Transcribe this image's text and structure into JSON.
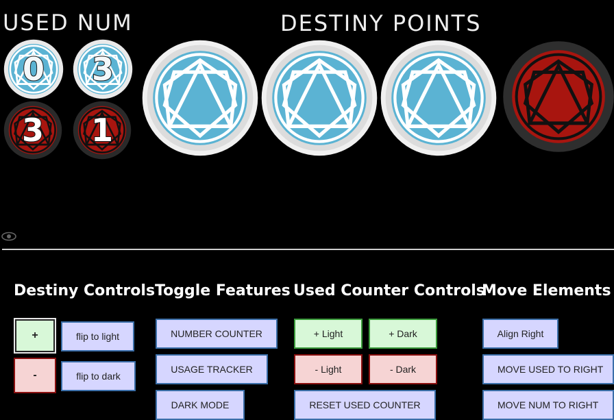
{
  "headers": {
    "used_num": "USED NUM",
    "destiny_points": "DESTINY POINTS"
  },
  "counters": {
    "light_used": "0",
    "light_num": "3",
    "dark_used": "3",
    "dark_num": "1"
  },
  "destiny_tokens": [
    "light",
    "light",
    "light",
    "dark"
  ],
  "colors": {
    "light_face": "#5bb3d3",
    "light_rim": "#e9e9e9",
    "dark_face": "#a8150f",
    "dark_rim": "#2a2a2a"
  },
  "sections": {
    "destiny_controls": {
      "title": "Destiny Controls",
      "plus": "+",
      "minus": "-",
      "flip_light": "flip to light",
      "flip_dark": "flip to dark"
    },
    "toggle_features": {
      "title": "Toggle Features",
      "number_counter": "NUMBER COUNTER",
      "usage_tracker": "USAGE TRACKER",
      "dark_mode": "DARK MODE"
    },
    "used_counter_controls": {
      "title": "Used Counter Controls",
      "plus_light": "+ Light",
      "plus_dark": "+ Dark",
      "minus_light": "- Light",
      "minus_dark": "- Dark",
      "reset": "RESET USED COUNTER"
    },
    "move_elements": {
      "title": "Move Elements",
      "align_right": "Align Right",
      "move_used": "MOVE USED TO RIGHT",
      "move_num": "MOVE NUM TO RIGHT"
    }
  }
}
